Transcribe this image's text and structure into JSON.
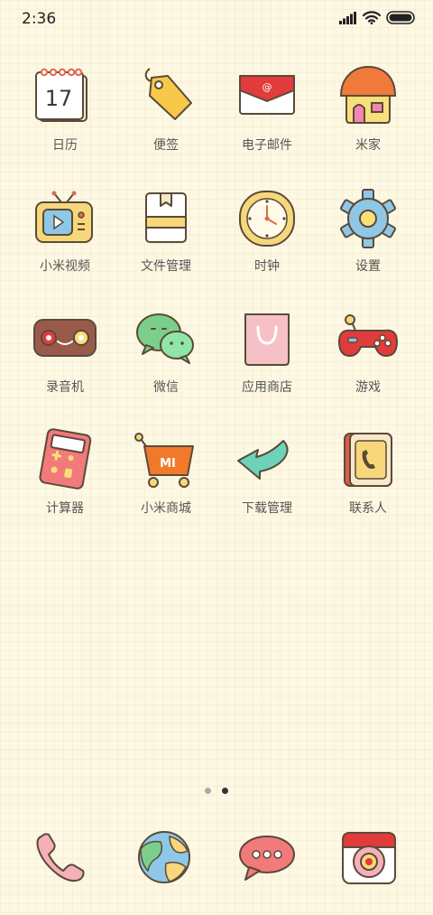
{
  "status_bar": {
    "time": "2:36",
    "icons": [
      "cellular-signal-icon",
      "wifi-icon",
      "battery-icon"
    ]
  },
  "apps": [
    {
      "label": "日历",
      "icon": "calendar-icon",
      "date_text": "17"
    },
    {
      "label": "便签",
      "icon": "notes-tag-icon"
    },
    {
      "label": "电子邮件",
      "icon": "email-envelope-icon"
    },
    {
      "label": "米家",
      "icon": "house-icon"
    },
    {
      "label": "小米视频",
      "icon": "tv-video-icon"
    },
    {
      "label": "文件管理",
      "icon": "file-box-icon"
    },
    {
      "label": "时钟",
      "icon": "clock-icon"
    },
    {
      "label": "设置",
      "icon": "gear-icon"
    },
    {
      "label": "录音机",
      "icon": "recorder-icon"
    },
    {
      "label": "微信",
      "icon": "wechat-icon"
    },
    {
      "label": "应用商店",
      "icon": "shopping-bag-icon"
    },
    {
      "label": "游戏",
      "icon": "gamepad-icon"
    },
    {
      "label": "计算器",
      "icon": "calculator-icon"
    },
    {
      "label": "小米商城",
      "icon": "shopping-cart-icon",
      "cart_text": "MI"
    },
    {
      "label": "下载管理",
      "icon": "download-arrow-icon"
    },
    {
      "label": "联系人",
      "icon": "contacts-book-icon"
    }
  ],
  "page_indicator": {
    "count": 2,
    "active_index": 1
  },
  "dock": [
    {
      "icon": "phone-icon"
    },
    {
      "icon": "browser-globe-icon"
    },
    {
      "icon": "messages-icon"
    },
    {
      "icon": "camera-icon"
    }
  ],
  "colors": {
    "background": "#fdf8e4",
    "label_text": "#555555",
    "outline": "#5a4a3a"
  }
}
